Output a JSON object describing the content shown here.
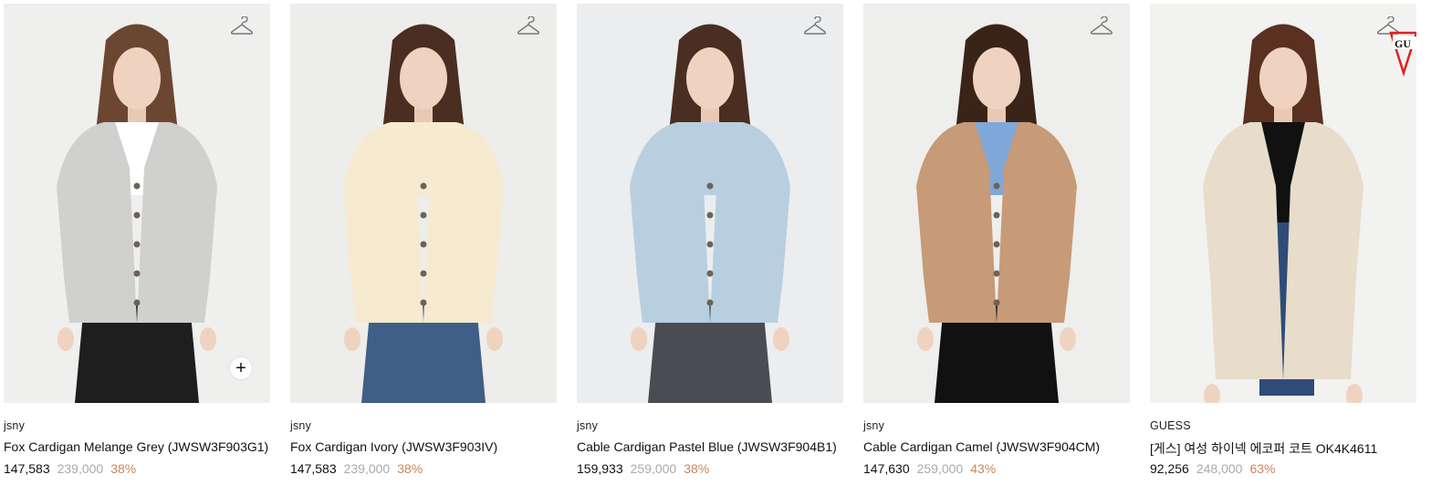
{
  "products": [
    {
      "brand": "jsny",
      "name": "Fox Cardigan Melange Grey (JWSW3F903G1)",
      "price": "147,583",
      "original_price": "239,000",
      "discount": "38%",
      "image": "model-grey-cardigan",
      "bg": "#efefee",
      "top": "#d0d0cf",
      "bottom": "#1e1e1e",
      "hair": "#6b4630",
      "inner": "#ffffff"
    },
    {
      "brand": "jsny",
      "name": "Fox Cardigan Ivory (JWSW3F903IV)",
      "price": "147,583",
      "original_price": "239,000",
      "discount": "38%",
      "image": "model-ivory-cardigan",
      "bg": "#ededeb",
      "top": "#f6ead0",
      "bottom": "#3f5f86",
      "hair": "#4a2e22",
      "inner": "#f6ead0"
    },
    {
      "brand": "jsny",
      "name": "Cable Cardigan Pastel Blue (JWSW3F904B1)",
      "price": "159,933",
      "original_price": "259,000",
      "discount": "38%",
      "image": "model-blue-cardigan",
      "bg": "#ebedef",
      "top": "#b8cfe0",
      "bottom": "#4a4c52",
      "hair": "#4a2e22",
      "inner": "#b8cfe0"
    },
    {
      "brand": "jsny",
      "name": "Cable Cardigan Camel (JWSW3F904CM)",
      "price": "147,630",
      "original_price": "259,000",
      "discount": "43%",
      "image": "model-camel-cardigan",
      "bg": "#eeeeec",
      "top": "#c79a78",
      "bottom": "#111111",
      "hair": "#3a2418",
      "inner": "#7fa8d8"
    },
    {
      "brand": "GUESS",
      "name": "[게스] 여성 하이넥 에코퍼 코트 OK4K4611",
      "price": "92,256",
      "original_price": "248,000",
      "discount": "63%",
      "image": "model-fleece-coat",
      "bg": "#f2f2f0",
      "top": "#e8dccb",
      "bottom": "#2f4c78",
      "hair": "#5a3020",
      "inner": "#111111"
    }
  ]
}
